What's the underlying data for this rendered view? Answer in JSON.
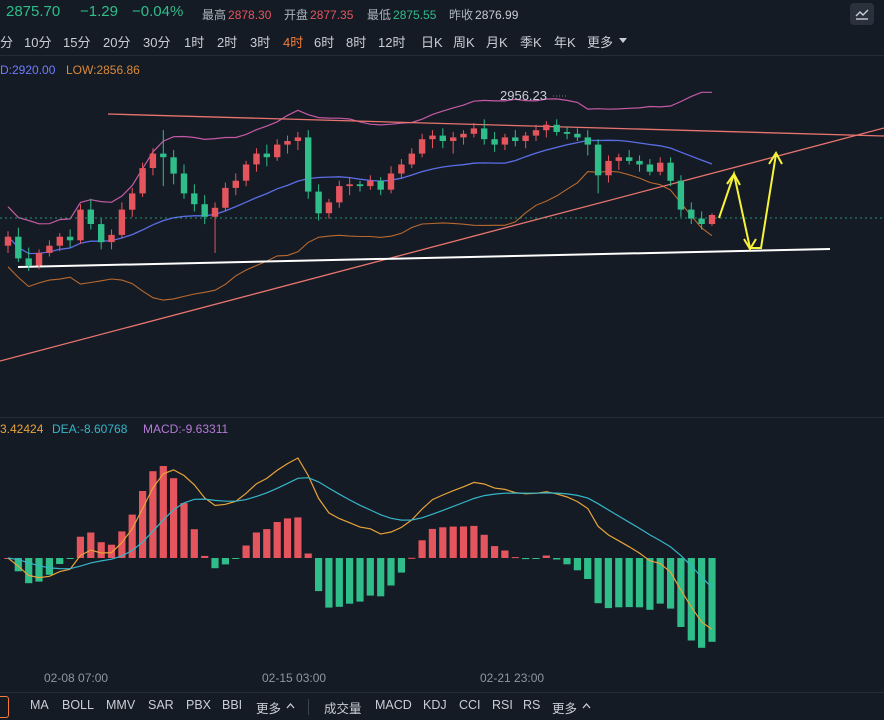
{
  "header": {
    "last_price": "2875.70",
    "change": "−1.29",
    "change_pct": "−0.04%",
    "high_label": "最高",
    "high_value": "2878.30",
    "open_label": "开盘",
    "open_value": "2877.35",
    "low_label": "最低",
    "low_value": "2875.55",
    "prev_close_label": "昨收",
    "prev_close_value": "2876.99"
  },
  "timeframes": [
    "分",
    "10分",
    "15分",
    "20分",
    "30分",
    "1时",
    "2时",
    "3时",
    "4时",
    "6时",
    "8时",
    "12时",
    "日K",
    "周K",
    "月K",
    "季K",
    "年K",
    "更多"
  ],
  "active_timeframe": "4时",
  "boll_legend": {
    "up": "D:2920.00",
    "low": "LOW:2856.86"
  },
  "macd_legend": {
    "dif": "3.42424",
    "dea": "DEA:-8.60768",
    "macd": "MACD:-9.63311"
  },
  "x_ticks": [
    "02-08 07:00",
    "02-15 03:00",
    "02-21 23:00"
  ],
  "toolbar_main": [
    "MA",
    "BOLL",
    "MMV",
    "SAR",
    "PBX",
    "BBI",
    "更多"
  ],
  "toolbar_sub": [
    "成交量",
    "MACD",
    "KDJ",
    "CCI",
    "RSI",
    "RS",
    "更多"
  ],
  "colors": {
    "up": "#e5555e",
    "down": "#2fbd8a",
    "bg": "#151b24",
    "accent": "#f27b3a"
  },
  "icons": {
    "settings": "chart-settings-icon",
    "chevron": "chevron-down-icon"
  },
  "chart_data": {
    "type": "candlestick",
    "annotation_high": "2956.23",
    "candles": [
      [
        2886,
        2894,
        2882,
        2891
      ],
      [
        2891,
        2896,
        2877,
        2879
      ],
      [
        2879,
        2885,
        2872,
        2875
      ],
      [
        2875,
        2884,
        2873,
        2882
      ],
      [
        2882,
        2889,
        2880,
        2886
      ],
      [
        2886,
        2893,
        2883,
        2891
      ],
      [
        2891,
        2895,
        2885,
        2889
      ],
      [
        2889,
        2909,
        2887,
        2906
      ],
      [
        2906,
        2912,
        2895,
        2898
      ],
      [
        2898,
        2901,
        2884,
        2888
      ],
      [
        2888,
        2895,
        2884,
        2892
      ],
      [
        2892,
        2910,
        2890,
        2906
      ],
      [
        2906,
        2918,
        2902,
        2915
      ],
      [
        2915,
        2932,
        2913,
        2929
      ],
      [
        2929,
        2940,
        2925,
        2937
      ],
      [
        2937,
        2950,
        2919,
        2935
      ],
      [
        2935,
        2939,
        2920,
        2926
      ],
      [
        2926,
        2931,
        2912,
        2915
      ],
      [
        2915,
        2920,
        2905,
        2909
      ],
      [
        2909,
        2914,
        2898,
        2902
      ],
      [
        2902,
        2910,
        2882,
        2907
      ],
      [
        2907,
        2921,
        2905,
        2918
      ],
      [
        2918,
        2926,
        2914,
        2922
      ],
      [
        2922,
        2933,
        2919,
        2931
      ],
      [
        2931,
        2940,
        2927,
        2937
      ],
      [
        2937,
        2942,
        2930,
        2935
      ],
      [
        2935,
        2945,
        2933,
        2942
      ],
      [
        2942,
        2947,
        2937,
        2944
      ],
      [
        2944,
        2949,
        2939,
        2946
      ],
      [
        2946,
        2950,
        2912,
        2916
      ],
      [
        2916,
        2920,
        2900,
        2904
      ],
      [
        2904,
        2912,
        2901,
        2910
      ],
      [
        2910,
        2922,
        2907,
        2919
      ],
      [
        2919,
        2924,
        2914,
        2920
      ],
      [
        2920,
        2922,
        2916,
        2919
      ],
      [
        2919,
        2925,
        2917,
        2922
      ],
      [
        2922,
        2924,
        2914,
        2917
      ],
      [
        2917,
        2930,
        2915,
        2926
      ],
      [
        2926,
        2934,
        2923,
        2931
      ],
      [
        2931,
        2940,
        2929,
        2937
      ],
      [
        2937,
        2948,
        2935,
        2945
      ],
      [
        2945,
        2950,
        2940,
        2947
      ],
      [
        2947,
        2951,
        2940,
        2944
      ],
      [
        2944,
        2949,
        2937,
        2946
      ],
      [
        2946,
        2950,
        2942,
        2948
      ],
      [
        2948,
        2954,
        2946,
        2951
      ],
      [
        2951,
        2956,
        2942,
        2945
      ],
      [
        2945,
        2949,
        2938,
        2942
      ],
      [
        2942,
        2948,
        2939,
        2946
      ],
      [
        2946,
        2950,
        2941,
        2944
      ],
      [
        2944,
        2949,
        2940,
        2947
      ],
      [
        2947,
        2953,
        2944,
        2950
      ],
      [
        2950,
        2955,
        2946,
        2953
      ],
      [
        2953,
        2956,
        2947,
        2949
      ],
      [
        2949,
        2952,
        2945,
        2948
      ],
      [
        2948,
        2951,
        2944,
        2946
      ],
      [
        2946,
        2950,
        2936,
        2942
      ],
      [
        2942,
        2945,
        2915,
        2925
      ],
      [
        2925,
        2936,
        2921,
        2933
      ],
      [
        2933,
        2937,
        2928,
        2935
      ],
      [
        2935,
        2939,
        2931,
        2933
      ],
      [
        2933,
        2936,
        2927,
        2931
      ],
      [
        2931,
        2934,
        2925,
        2927
      ],
      [
        2927,
        2935,
        2925,
        2932
      ],
      [
        2932,
        2935,
        2919,
        2922
      ],
      [
        2922,
        2925,
        2902,
        2906
      ],
      [
        2906,
        2910,
        2898,
        2901
      ],
      [
        2901,
        2905,
        2895,
        2898
      ],
      [
        2898,
        2904,
        2897,
        2903
      ]
    ],
    "boll_mid_label": "MID",
    "trendlines": [
      "resistance",
      "rising support",
      "horizontal support"
    ],
    "macd": {
      "dif_label": "DIF",
      "dea_label": "DEA",
      "hist_label": "MACD"
    }
  }
}
